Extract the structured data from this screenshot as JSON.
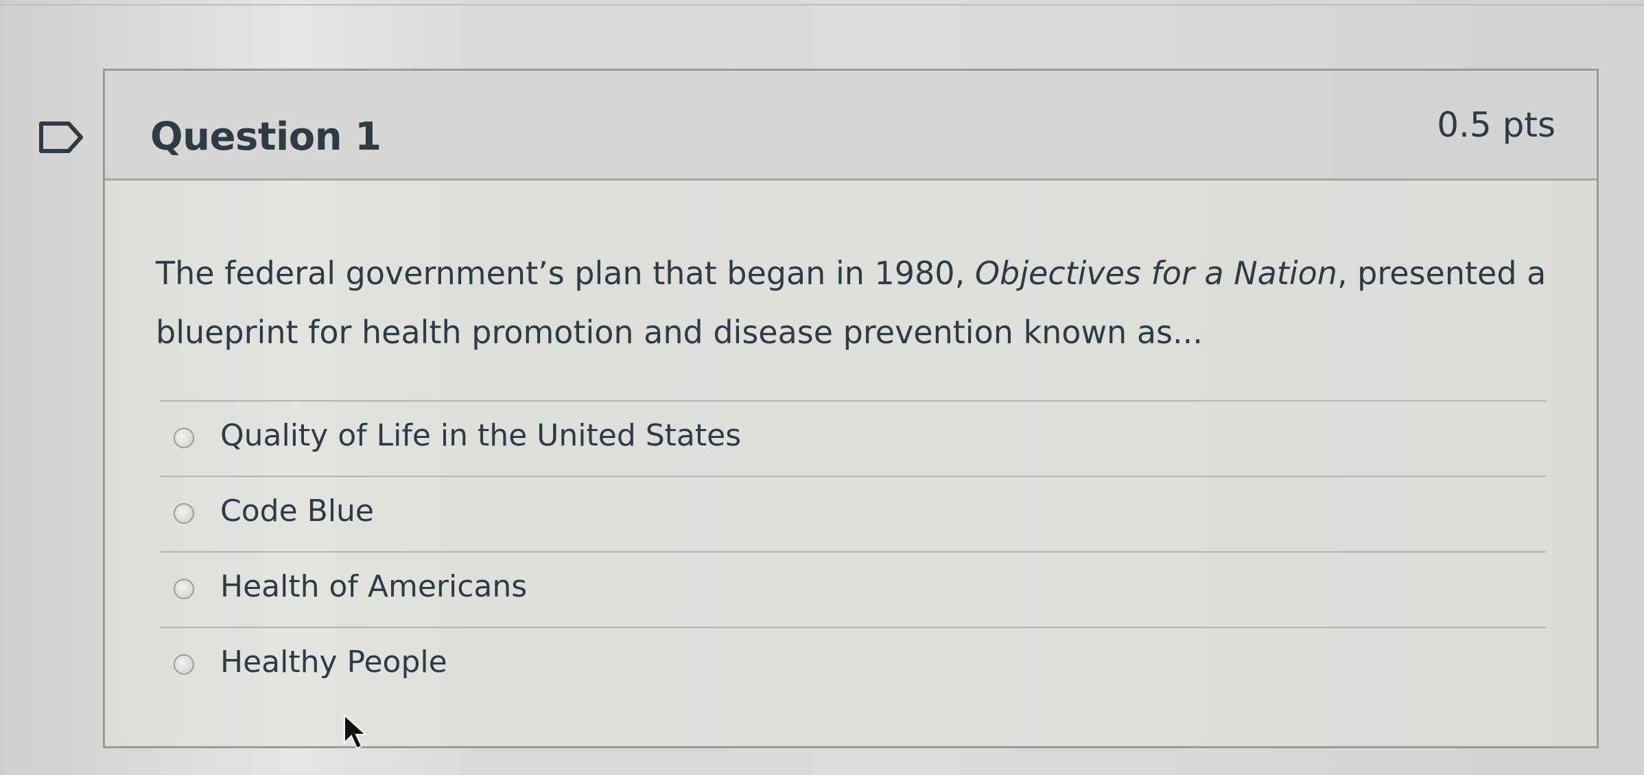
{
  "question": {
    "title": "Question 1",
    "points": "0.5 pts",
    "text_before": "The federal government’s plan that began in 1980, ",
    "text_italic": "Objectives for a Nation",
    "text_after": ", presented a blueprint for health promotion and disease prevention known as..."
  },
  "answers": [
    {
      "label": "Quality of Life in the United States"
    },
    {
      "label": "Code Blue"
    },
    {
      "label": "Health of Americans"
    },
    {
      "label": "Healthy People"
    }
  ],
  "icons": {
    "flag": "flag-question-icon",
    "radio": "radio-unchecked-icon",
    "cursor": "mouse-pointer-icon"
  },
  "colors": {
    "text": "#2d3b45",
    "border": "#9a9a98"
  }
}
